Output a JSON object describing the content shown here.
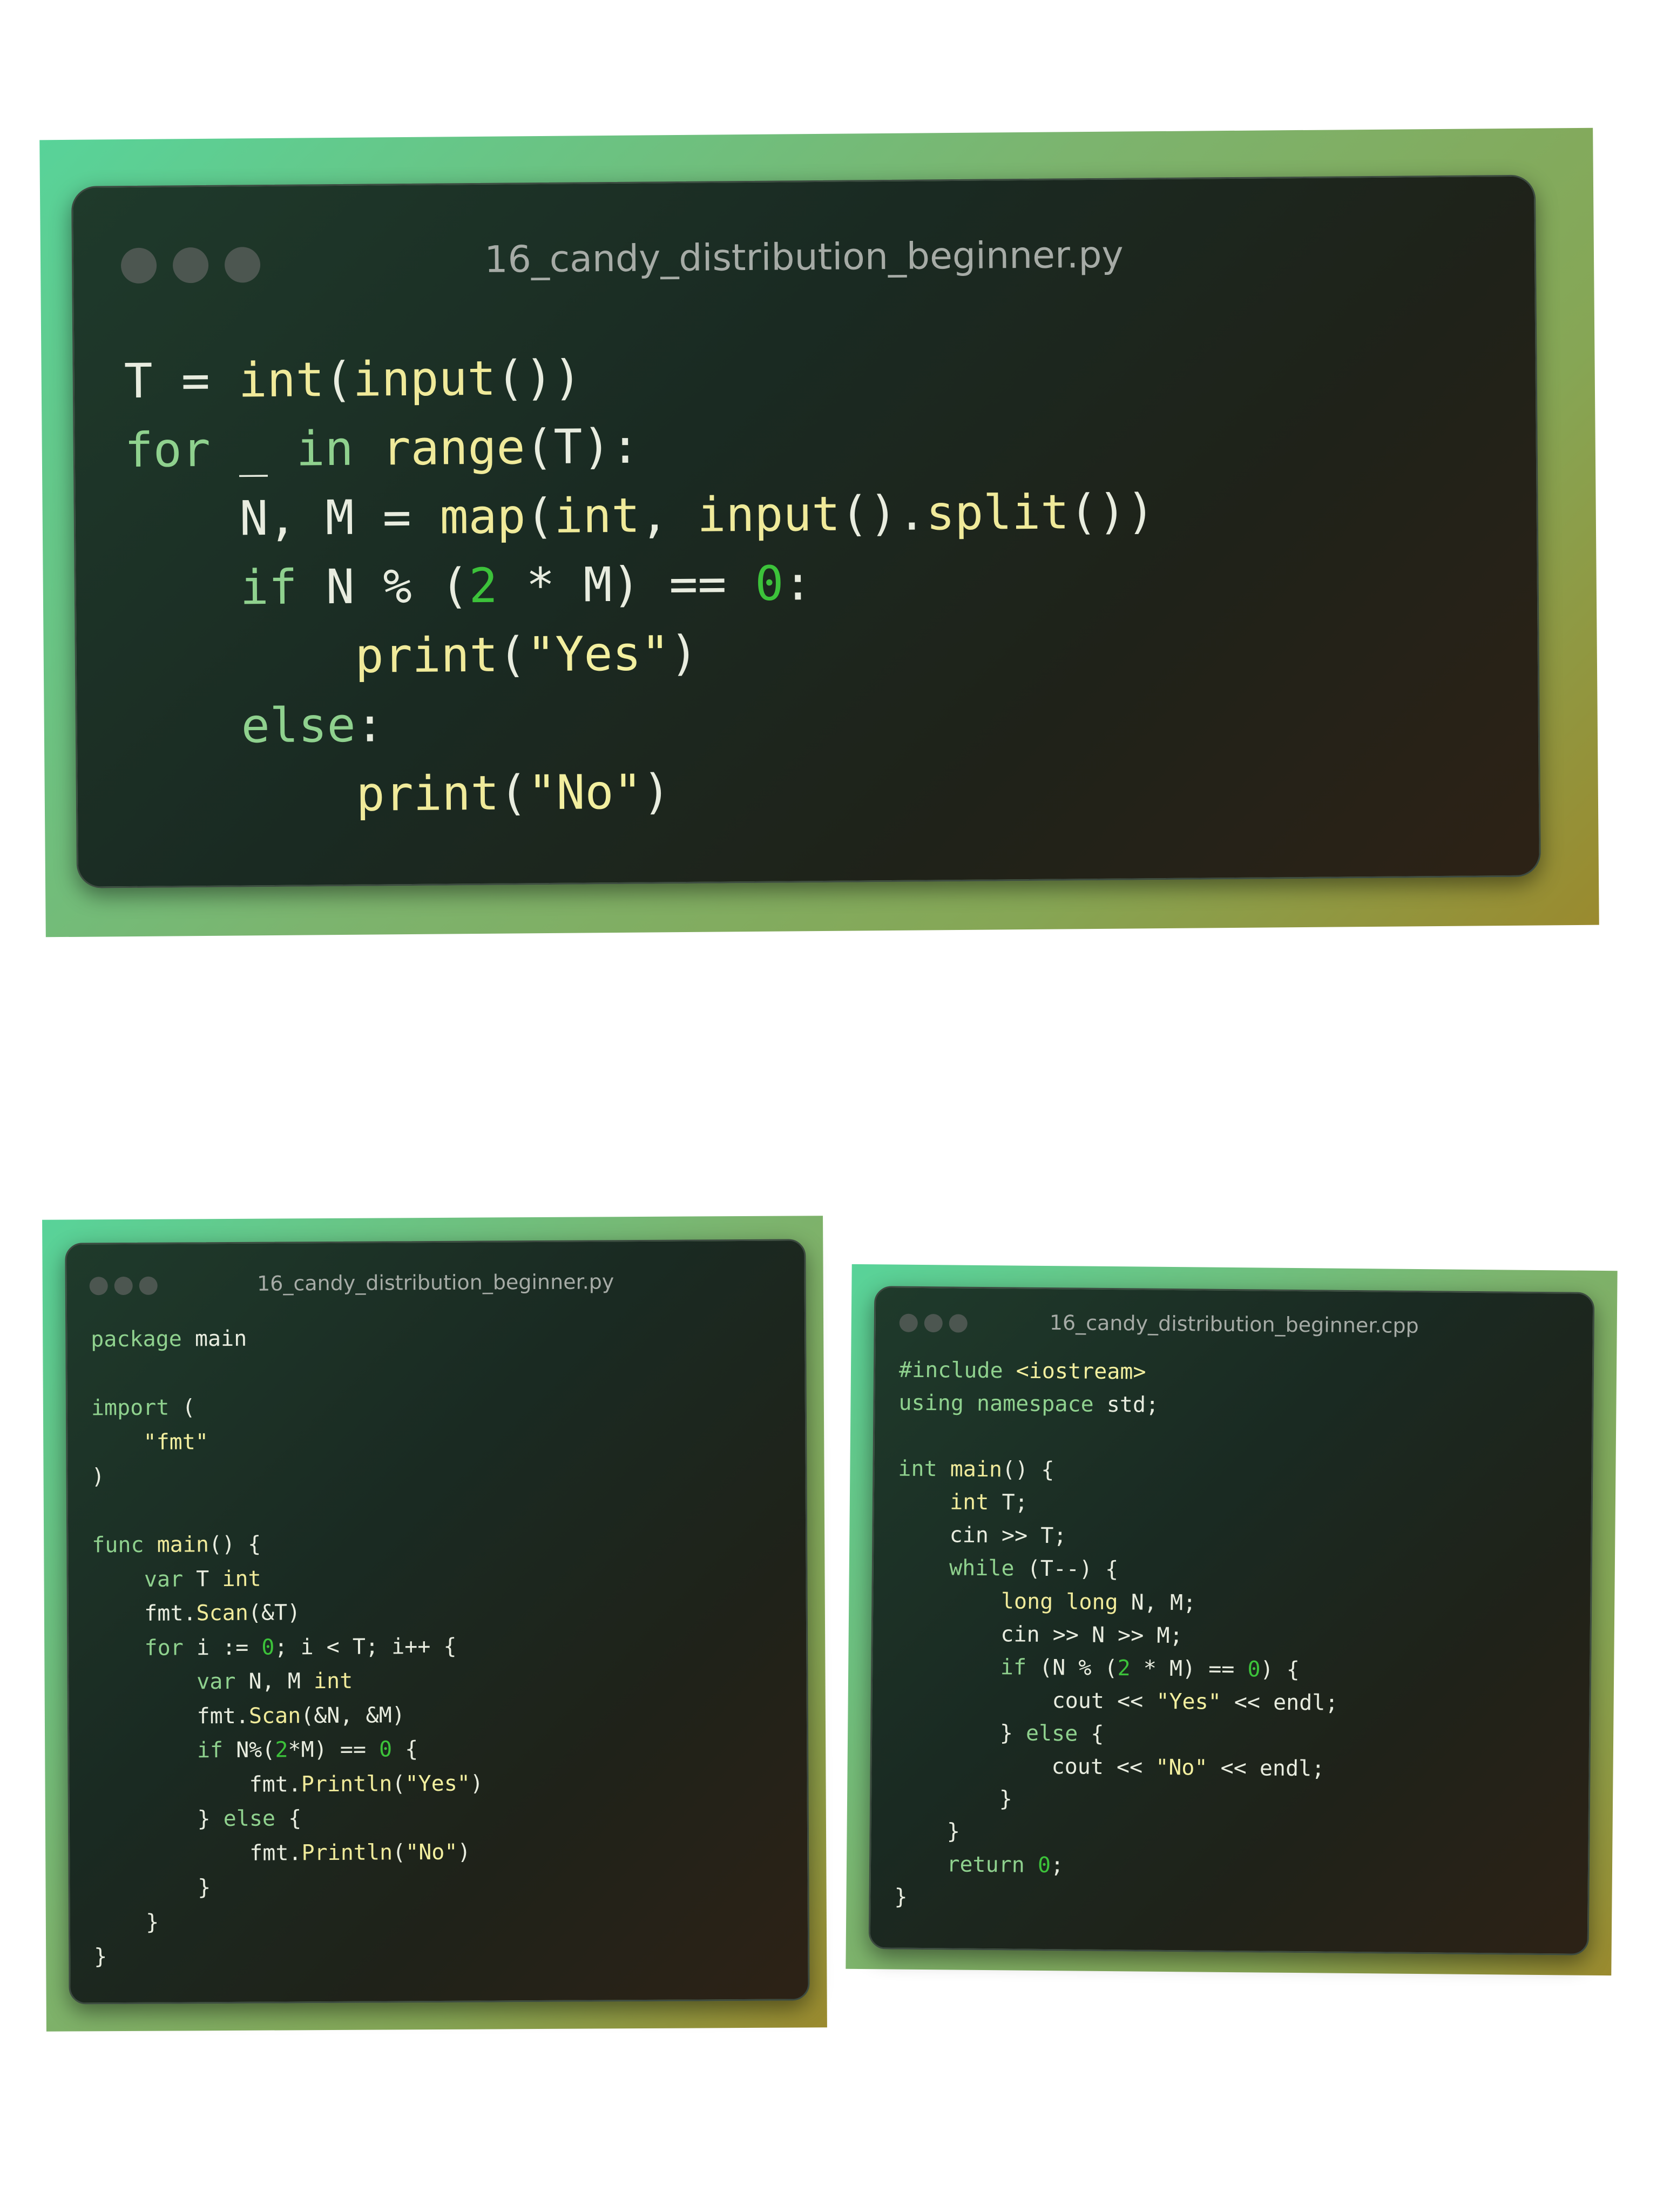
{
  "cards": [
    {
      "filename": "16_candy_distribution_beginner.py",
      "language": "python",
      "lines": [
        [
          [
            "T = ",
            ""
          ],
          [
            "int",
            "fn"
          ],
          [
            "(",
            ""
          ],
          [
            "input",
            "fn"
          ],
          [
            "())",
            ""
          ]
        ],
        [
          [
            "for",
            "kw"
          ],
          [
            " _ ",
            ""
          ],
          [
            "in",
            "kw"
          ],
          [
            " ",
            ""
          ],
          [
            "range",
            "fn"
          ],
          [
            "(T):",
            ""
          ]
        ],
        [
          [
            "    N, M = ",
            ""
          ],
          [
            "map",
            "fn"
          ],
          [
            "(",
            ""
          ],
          [
            "int",
            "fn"
          ],
          [
            ", ",
            ""
          ],
          [
            "input",
            "fn"
          ],
          [
            "().",
            ""
          ],
          [
            "split",
            "fn"
          ],
          [
            "())",
            ""
          ]
        ],
        [
          [
            "    ",
            ""
          ],
          [
            "if",
            "kw"
          ],
          [
            " N % (",
            ""
          ],
          [
            "2",
            "num"
          ],
          [
            " * M) == ",
            ""
          ],
          [
            "0",
            "num"
          ],
          [
            ":",
            ""
          ]
        ],
        [
          [
            "        ",
            ""
          ],
          [
            "print",
            "fn"
          ],
          [
            "(",
            ""
          ],
          [
            "\"Yes\"",
            "str"
          ],
          [
            ")",
            ""
          ]
        ],
        [
          [
            "    ",
            ""
          ],
          [
            "else",
            "kw"
          ],
          [
            ":",
            ""
          ]
        ],
        [
          [
            "        ",
            ""
          ],
          [
            "print",
            "fn"
          ],
          [
            "(",
            ""
          ],
          [
            "\"No\"",
            "str"
          ],
          [
            ")",
            ""
          ]
        ]
      ]
    },
    {
      "filename": "16_candy_distribution_beginner.py",
      "language": "go",
      "lines": [
        [
          [
            "package",
            "kw"
          ],
          [
            " main",
            ""
          ]
        ],
        [
          [
            "",
            ""
          ]
        ],
        [
          [
            "import",
            "kw"
          ],
          [
            " (",
            ""
          ]
        ],
        [
          [
            "    ",
            ""
          ],
          [
            "\"fmt\"",
            "str"
          ]
        ],
        [
          [
            ")",
            ""
          ]
        ],
        [
          [
            "",
            ""
          ]
        ],
        [
          [
            "func",
            "kw"
          ],
          [
            " ",
            ""
          ],
          [
            "main",
            "fn"
          ],
          [
            "() {",
            ""
          ]
        ],
        [
          [
            "    ",
            ""
          ],
          [
            "var",
            "kw"
          ],
          [
            " T ",
            ""
          ],
          [
            "int",
            "fn"
          ]
        ],
        [
          [
            "    fmt.",
            ""
          ],
          [
            "Scan",
            "fn"
          ],
          [
            "(&T)",
            ""
          ]
        ],
        [
          [
            "    ",
            ""
          ],
          [
            "for",
            "kw"
          ],
          [
            " i := ",
            ""
          ],
          [
            "0",
            "num"
          ],
          [
            "; i < T; i++ {",
            ""
          ]
        ],
        [
          [
            "        ",
            ""
          ],
          [
            "var",
            "kw"
          ],
          [
            " N, M ",
            ""
          ],
          [
            "int",
            "fn"
          ]
        ],
        [
          [
            "        fmt.",
            ""
          ],
          [
            "Scan",
            "fn"
          ],
          [
            "(&N, &M)",
            ""
          ]
        ],
        [
          [
            "        ",
            ""
          ],
          [
            "if",
            "kw"
          ],
          [
            " N%(",
            ""
          ],
          [
            "2",
            "num"
          ],
          [
            "*M) == ",
            ""
          ],
          [
            "0",
            "num"
          ],
          [
            " {",
            ""
          ]
        ],
        [
          [
            "            fmt.",
            ""
          ],
          [
            "Println",
            "fn"
          ],
          [
            "(",
            ""
          ],
          [
            "\"Yes\"",
            "str"
          ],
          [
            ")",
            ""
          ]
        ],
        [
          [
            "        } ",
            ""
          ],
          [
            "else",
            "kw"
          ],
          [
            " {",
            ""
          ]
        ],
        [
          [
            "            fmt.",
            ""
          ],
          [
            "Println",
            "fn"
          ],
          [
            "(",
            ""
          ],
          [
            "\"No\"",
            "str"
          ],
          [
            ")",
            ""
          ]
        ],
        [
          [
            "        }",
            ""
          ]
        ],
        [
          [
            "    }",
            ""
          ]
        ],
        [
          [
            "}",
            ""
          ]
        ]
      ]
    },
    {
      "filename": "16_candy_distribution_beginner.cpp",
      "language": "cpp",
      "lines": [
        [
          [
            "#include",
            "inc"
          ],
          [
            " ",
            ""
          ],
          [
            "<iostream>",
            "str"
          ]
        ],
        [
          [
            "using",
            "kw"
          ],
          [
            " ",
            ""
          ],
          [
            "namespace",
            "kw"
          ],
          [
            " std;",
            ""
          ]
        ],
        [
          [
            "",
            ""
          ]
        ],
        [
          [
            "int",
            "kw"
          ],
          [
            " ",
            ""
          ],
          [
            "main",
            "fn"
          ],
          [
            "() {",
            ""
          ]
        ],
        [
          [
            "    ",
            ""
          ],
          [
            "int",
            "fn"
          ],
          [
            " T;",
            ""
          ]
        ],
        [
          [
            "    cin >> T;",
            ""
          ]
        ],
        [
          [
            "    ",
            ""
          ],
          [
            "while",
            "kw"
          ],
          [
            " (T--) {",
            ""
          ]
        ],
        [
          [
            "        ",
            ""
          ],
          [
            "long long",
            "fn"
          ],
          [
            " N, M;",
            ""
          ]
        ],
        [
          [
            "        cin >> N >> M;",
            ""
          ]
        ],
        [
          [
            "        ",
            ""
          ],
          [
            "if",
            "kw"
          ],
          [
            " (N % (",
            ""
          ],
          [
            "2",
            "num"
          ],
          [
            " * M) == ",
            ""
          ],
          [
            "0",
            "num"
          ],
          [
            ") {",
            ""
          ]
        ],
        [
          [
            "            cout << ",
            ""
          ],
          [
            "\"Yes\"",
            "str"
          ],
          [
            " << endl;",
            ""
          ]
        ],
        [
          [
            "        } ",
            ""
          ],
          [
            "else",
            "kw"
          ],
          [
            " {",
            ""
          ]
        ],
        [
          [
            "            cout << ",
            ""
          ],
          [
            "\"No\"",
            "str"
          ],
          [
            " << endl;",
            ""
          ]
        ],
        [
          [
            "        }",
            ""
          ]
        ],
        [
          [
            "    }",
            ""
          ]
        ],
        [
          [
            "    ",
            ""
          ],
          [
            "return",
            "kw"
          ],
          [
            " ",
            ""
          ],
          [
            "0",
            "num"
          ],
          [
            ";",
            ""
          ]
        ],
        [
          [
            "}",
            ""
          ]
        ]
      ]
    }
  ]
}
